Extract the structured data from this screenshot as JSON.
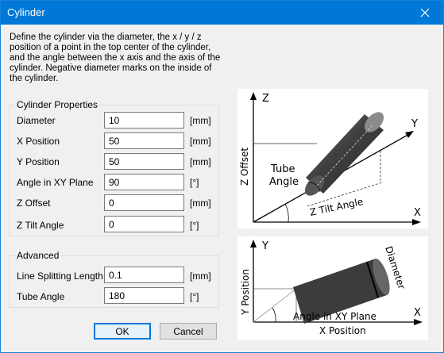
{
  "window": {
    "title": "Cylinder"
  },
  "description": "Define the cylinder via the diameter, the x / y / z position of a point in the top center of the cylinder, and the angle between the x axis and the axis of the cylinder. Negative diameter marks on the inside of the cylinder.",
  "cylinder_properties": {
    "title": "Cylinder Properties",
    "rows": [
      {
        "label": "Diameter",
        "value": "10",
        "unit": "[mm]"
      },
      {
        "label": "X Position",
        "value": "50",
        "unit": "[mm]"
      },
      {
        "label": "Y Position",
        "value": "50",
        "unit": "[mm]"
      },
      {
        "label": "Angle in XY Plane",
        "value": "90",
        "unit": "[°]"
      },
      {
        "label": "Z Offset",
        "value": "0",
        "unit": "[mm]"
      },
      {
        "label": "Z Tilt Angle",
        "value": "0",
        "unit": "[°]"
      }
    ]
  },
  "advanced": {
    "title": "Advanced",
    "rows": [
      {
        "label": "Line Splitting Length",
        "value": "0.1",
        "unit": "[mm]"
      },
      {
        "label": "Tube Angle",
        "value": "180",
        "unit": "[°]"
      }
    ]
  },
  "buttons": {
    "ok": "OK",
    "cancel": "Cancel"
  },
  "diagram_top": {
    "axis_z": "Z",
    "axis_y": "Y",
    "axis_x": "X",
    "z_offset": "Z Offset",
    "tube_angle_1": "Tube",
    "tube_angle_2": "Angle",
    "z_tilt_angle": "Z Tilt Angle"
  },
  "diagram_bottom": {
    "axis_y": "Y",
    "axis_x": "X",
    "y_position": "Y Position",
    "x_position": "X Position",
    "diameter": "Diameter",
    "angle_xy": "Angle in XY Plane"
  },
  "colors": {
    "titlebar": "#0078d7",
    "dialog_bg": "#f0f0f0",
    "default_button_border": "#0078d7"
  }
}
